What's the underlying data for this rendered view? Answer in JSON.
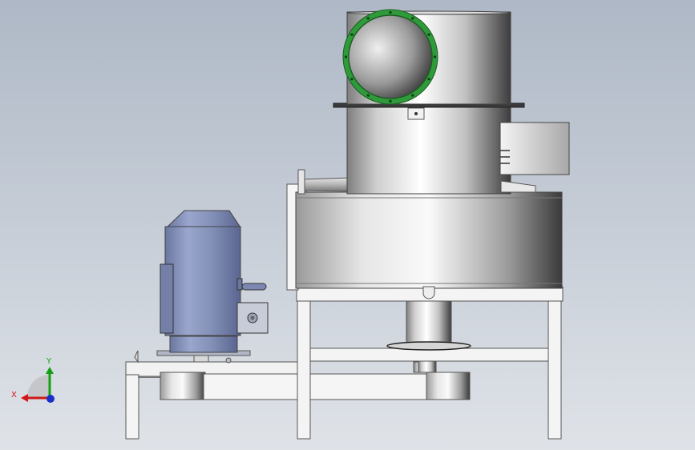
{
  "viewport": {
    "background_top": "#aeb8c6",
    "background_bottom": "#dfe3e8"
  },
  "triad": {
    "x_label": "X",
    "y_label": "Y",
    "x_color": "#d01818",
    "y_color": "#14a014",
    "z_color": "#1830c8"
  },
  "colors": {
    "flange_ring": "#2e9a3a",
    "motor_body": "#8290b6",
    "frame": "#f2f2f2",
    "steel_light": "#f4f4f4",
    "steel_dark": "#4a4a4a"
  }
}
